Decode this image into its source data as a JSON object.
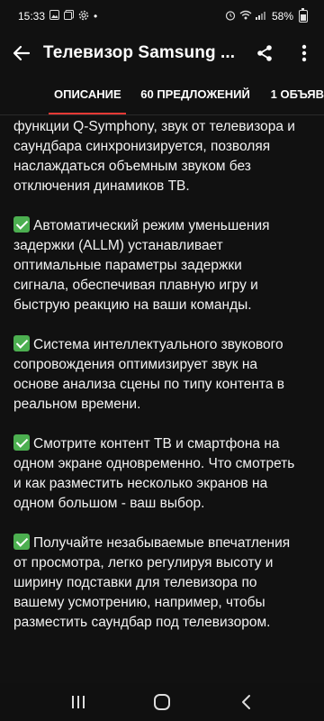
{
  "status_bar": {
    "time": "15:33",
    "dot": "•",
    "battery": "58%",
    "battery_level": 0.58,
    "left_icons": [
      "image-icon",
      "gallery-icon",
      "settings-icon"
    ],
    "right_icons": [
      "alarm-icon",
      "wifi-icon",
      "signal-icon"
    ]
  },
  "app_bar": {
    "title": "Телевизор Samsung ...",
    "back_icon": "arrow-left-icon",
    "actions": [
      "share-icon",
      "more-vertical-icon"
    ]
  },
  "tabs": [
    {
      "label": "ОПИСАНИЕ",
      "active": true
    },
    {
      "label": "60 ПРЕДЛОЖЕНИЙ",
      "active": false
    },
    {
      "label": "1 ОБЪЯВ",
      "active": false
    }
  ],
  "content": {
    "paragraphs": [
      {
        "check": false,
        "text": "функции Q-Symphony, звук от телевизора и саундбара синхронизируется, позволяя наслаждаться объемным звуком без отключения динамиков ТВ."
      },
      {
        "check": true,
        "text": "Автоматический режим уменьшения задержки (ALLM) устанавливает оптимальные параметры задержки сигнала, обеспечивая плавную игру и быструю реакцию на ваши команды."
      },
      {
        "check": true,
        "text": "Система интеллектуального звукового сопровождения оптимизирует звук на основе анализа сцены по типу контента в реальном времени."
      },
      {
        "check": true,
        "text": "Смотрите контент ТВ и смартфона на одном экране одновременно. Что смотреть и как разместить несколько экранов на одном большом - ваш выбор."
      },
      {
        "check": true,
        "text": "Получайте незабываемые впечатления от просмотра, легко регулируя высоту и ширину подставки для телевизора по вашему усмотрению, например, чтобы разместить саундбар под телевизором."
      }
    ]
  },
  "nav_bar": {
    "buttons": [
      "recent-apps-icon",
      "home-icon",
      "back-icon"
    ]
  }
}
